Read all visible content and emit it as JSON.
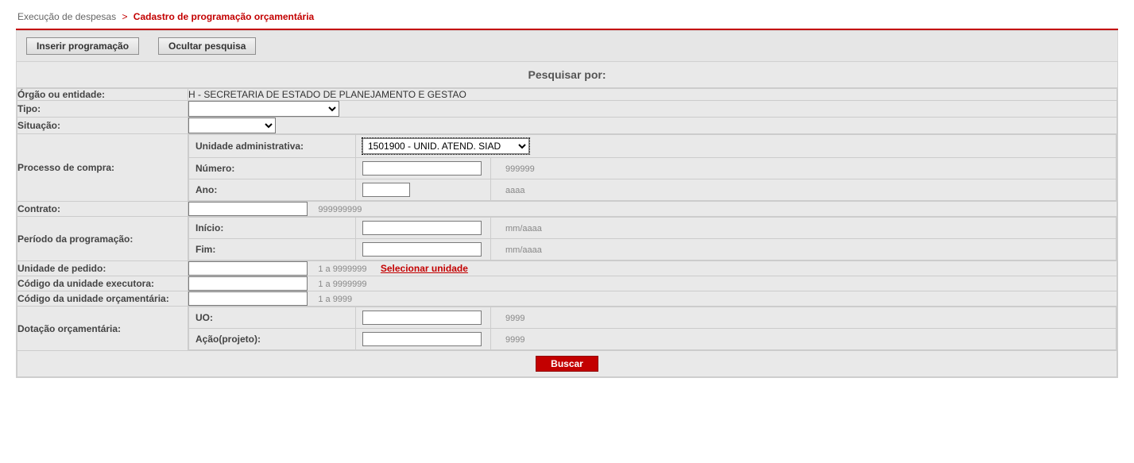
{
  "breadcrumb": {
    "root": "Execução de despesas",
    "sep": ">",
    "current": "Cadastro de programação orçamentária"
  },
  "toolbar": {
    "insert_label": "Inserir programação",
    "hide_label": "Ocultar pesquisa"
  },
  "panel": {
    "title": "Pesquisar por:"
  },
  "fields": {
    "orgao_label": "Órgão ou entidade:",
    "orgao_value": "H - SECRETARIA DE ESTADO DE PLANEJAMENTO E GESTAO",
    "tipo_label": "Tipo:",
    "situacao_label": "Situação:",
    "processo_label": "Processo de compra:",
    "unidade_admin_label": "Unidade administrativa:",
    "unidade_admin_selected": "1501900 - UNID. ATEND. SIAD",
    "numero_label": "Número:",
    "numero_hint": "999999",
    "ano_label": "Ano:",
    "ano_hint": "aaaa",
    "contrato_label": "Contrato:",
    "contrato_hint": "999999999",
    "periodo_label": "Período da programação:",
    "inicio_label": "Início:",
    "inicio_hint": "mm/aaaa",
    "fim_label": "Fim:",
    "fim_hint": "mm/aaaa",
    "unidade_pedido_label": "Unidade de pedido:",
    "unidade_pedido_hint": "1 a 9999999",
    "selecionar_unidade": "Selecionar unidade",
    "cod_exec_label": "Código da unidade executora:",
    "cod_exec_hint": "1 a 9999999",
    "cod_orc_label": "Código da unidade orçamentária:",
    "cod_orc_hint": "1 a 9999",
    "dotacao_label": "Dotação orçamentária:",
    "uo_label": "UO:",
    "uo_hint": "9999",
    "acao_label": "Ação(projeto):",
    "acao_hint": "9999"
  },
  "footer": {
    "buscar": "Buscar"
  }
}
